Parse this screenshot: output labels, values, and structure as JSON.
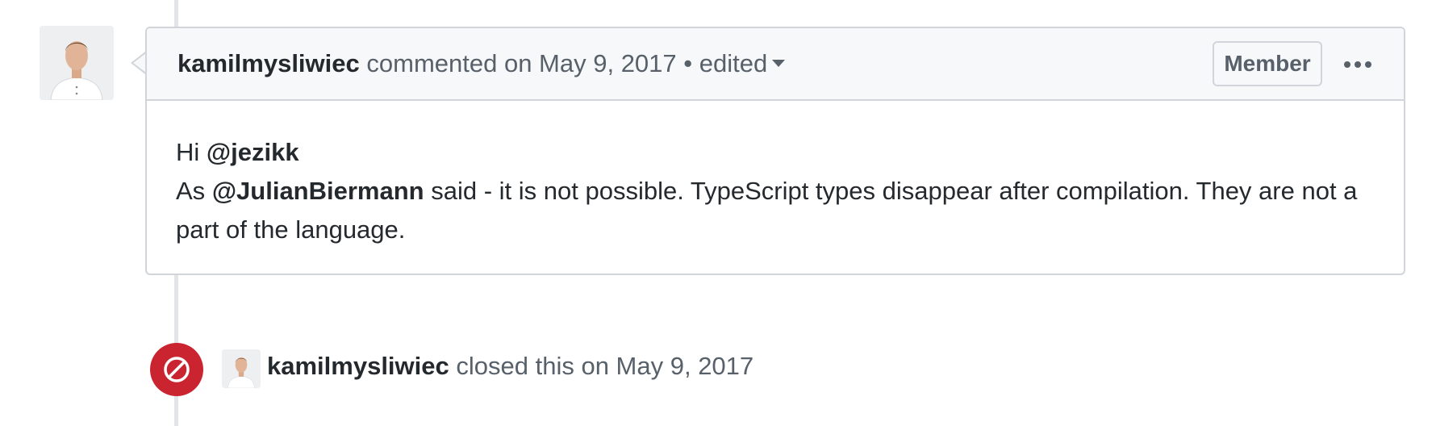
{
  "comment": {
    "author": "kamilmysliwiec",
    "action_text": "commented on May 9, 2017",
    "separator": "•",
    "edited_label": "edited",
    "badge": "Member",
    "more_icon": "kebab-horizontal-icon",
    "body": {
      "greeting": "Hi",
      "greeting_mention": "@jezikk",
      "line2_prefix": "As",
      "line2_mention": "@JulianBiermann",
      "line2_text": "said - it is not possible. TypeScript types disappear after compilation. They are not a part of the language."
    }
  },
  "event": {
    "icon": "circle-slash-icon",
    "actor": "kamilmysliwiec",
    "text": "closed this on May 9, 2017"
  },
  "colors": {
    "closed_red": "#cb2431",
    "border": "#d1d5da",
    "header_bg": "#f6f8fa",
    "muted_text": "#586069",
    "text": "#24292e"
  }
}
